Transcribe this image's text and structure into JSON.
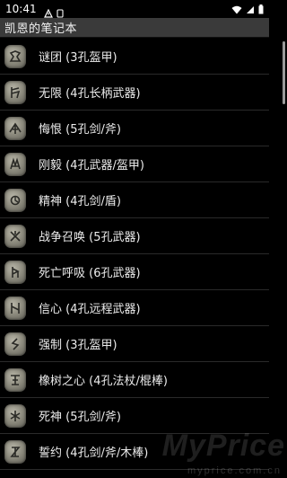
{
  "status_bar": {
    "time": "10:41",
    "left_icons": [
      "alert-icon",
      "sim-icon"
    ],
    "right_icons": [
      "wifi-icon",
      "signal-icon",
      "battery-icon"
    ]
  },
  "app_bar": {
    "title": "凯恩的笔记本"
  },
  "list": {
    "items": [
      {
        "label": "谜团 (3孔盔甲)"
      },
      {
        "label": "无限 (4孔长柄武器)"
      },
      {
        "label": "悔恨 (5孔剑/斧)"
      },
      {
        "label": "刚毅 (4孔武器/盔甲)"
      },
      {
        "label": "精神 (4孔剑/盾)"
      },
      {
        "label": "战争召唤 (5孔武器)"
      },
      {
        "label": "死亡呼吸 (6孔武器)"
      },
      {
        "label": "信心 (4孔远程武器)"
      },
      {
        "label": "强制 (3孔盔甲)"
      },
      {
        "label": "橡树之心 (4孔法杖/棍棒)"
      },
      {
        "label": "死神 (5孔剑/斧)"
      },
      {
        "label": "誓约 (4孔剑/斧/木棒)"
      }
    ]
  },
  "watermark": {
    "main": "MyPrice",
    "sub": "myprice.com.cn"
  }
}
